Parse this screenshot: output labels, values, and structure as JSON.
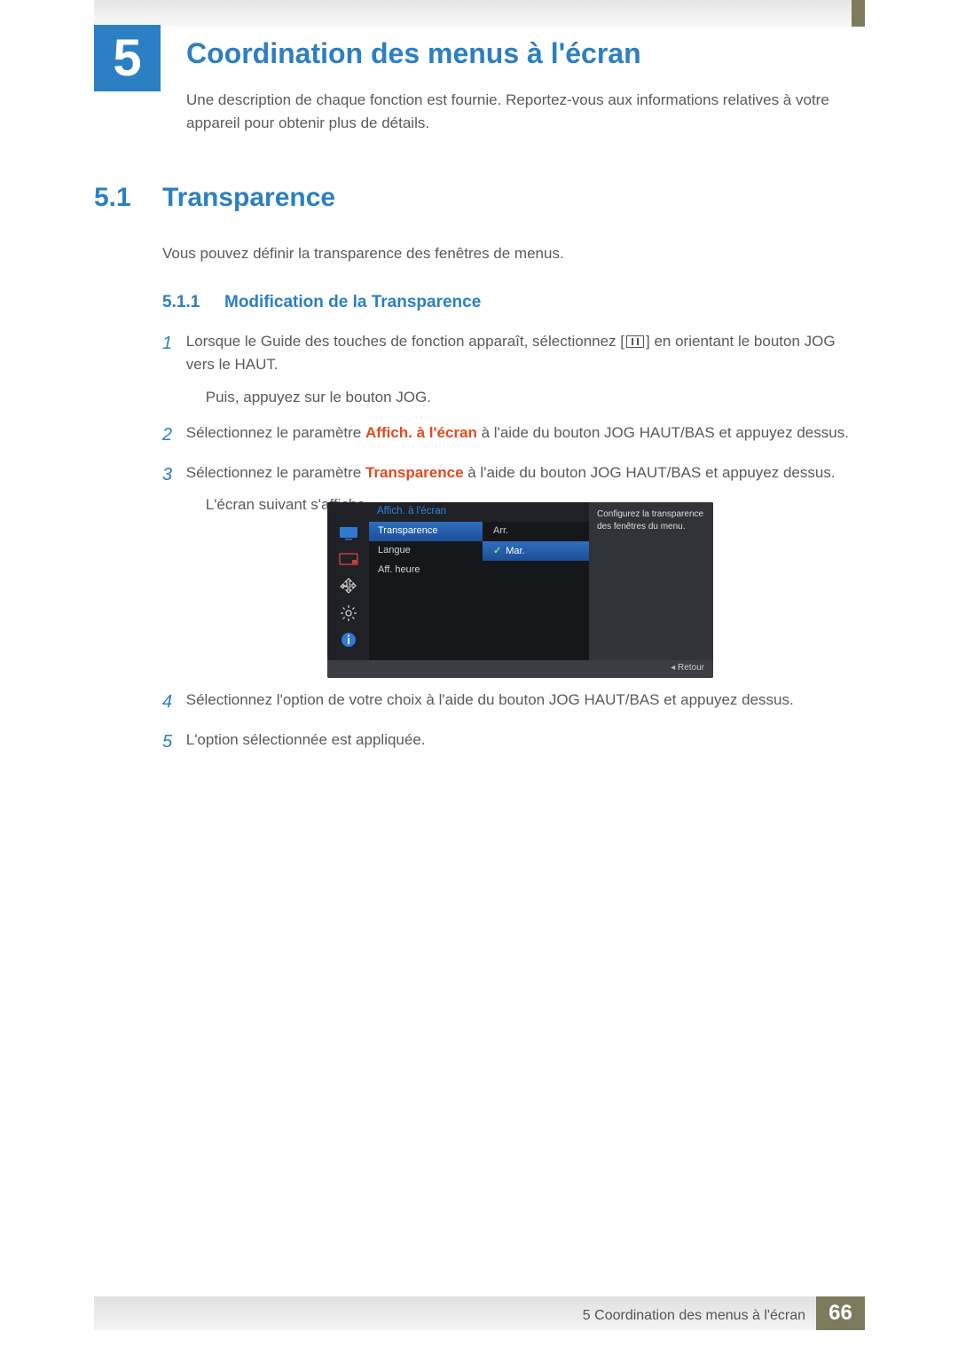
{
  "chapter": {
    "number": "5",
    "title": "Coordination des menus à l'écran",
    "description": "Une description de chaque fonction est fournie. Reportez-vous aux informations relatives à votre appareil pour obtenir plus de détails."
  },
  "section": {
    "number": "5.1",
    "title": "Transparence",
    "intro": "Vous pouvez définir la transparence des fenêtres de menus."
  },
  "subsection": {
    "number": "5.1.1",
    "title": "Modification de la Transparence"
  },
  "steps": {
    "s1_a": "Lorsque le Guide des touches de fonction apparaît, sélectionnez [",
    "s1_b": "] en orientant le bouton JOG vers le HAUT.",
    "s1_sub": "Puis, appuyez sur le bouton JOG.",
    "s2_a": "Sélectionnez le paramètre ",
    "s2_red": "Affich. à l'écran",
    "s2_b": " à l'aide du bouton JOG HAUT/BAS et appuyez dessus.",
    "s3_a": "Sélectionnez le paramètre ",
    "s3_red": "Transparence",
    "s3_b": " à l'aide du bouton JOG HAUT/BAS et appuyez dessus.",
    "s3_sub": "L'écran suivant s'affiche.",
    "s4": "Sélectionnez l'option de votre choix à l'aide du bouton JOG HAUT/BAS et appuyez dessus.",
    "s5": "L'option sélectionnée est appliquée."
  },
  "step_numbers": {
    "n1": "1",
    "n2": "2",
    "n3": "3",
    "n4": "4",
    "n5": "5"
  },
  "osd": {
    "panel_title": "Affich. à l'écran",
    "menu": {
      "transparence": "Transparence",
      "langue": "Langue",
      "aff_heure": "Aff. heure"
    },
    "options": {
      "arr": "Arr.",
      "mar": "Mar."
    },
    "side_text": "Configurez la transparence des fenêtres du menu.",
    "retour": "Retour"
  },
  "footer": {
    "label": "5 Coordination des menus à l'écran",
    "page": "66"
  }
}
